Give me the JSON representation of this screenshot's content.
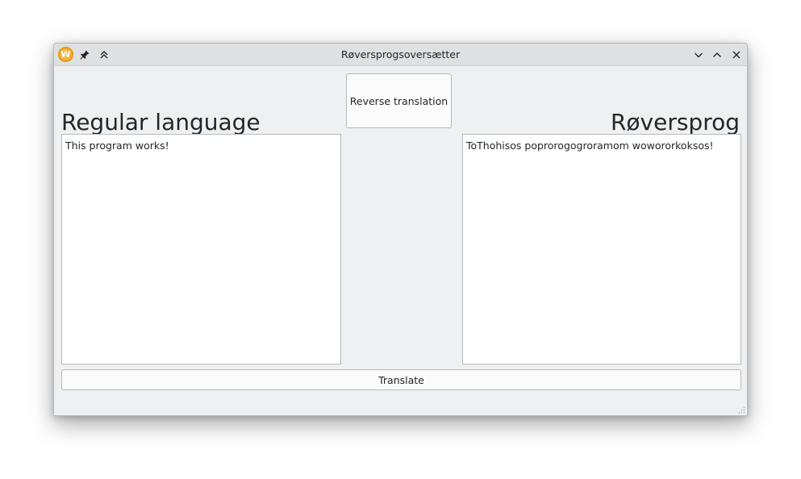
{
  "window": {
    "title": "Røversprogsoversætter"
  },
  "titlebar": {
    "app_icon_letter": "W",
    "icons": {
      "app": "app-logo-icon",
      "pin": "pin-icon",
      "keep_above": "double-chevron-up-icon",
      "minimize": "chevron-down-icon",
      "maximize": "chevron-up-icon",
      "close": "close-icon"
    }
  },
  "main": {
    "left_heading": "Regular language",
    "right_heading": "Røversprog",
    "reverse_button_label": "Reverse translation",
    "input_text": "This program works!",
    "output_text": "ToThohisos poprorogogroramom wowororkoksos!",
    "translate_button_label": "Translate"
  },
  "colors": {
    "window_bg": "#eff0f1",
    "titlebar_bg": "#dee0e2",
    "text": "#232629",
    "field_border": "#b7b9bb",
    "app_icon": "#f2b43a"
  }
}
